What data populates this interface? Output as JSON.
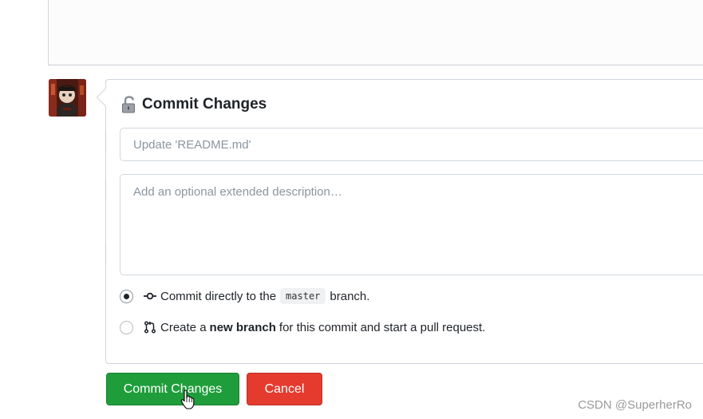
{
  "commit": {
    "title": "Commit Changes",
    "summary_placeholder": "Update 'README.md'",
    "description_placeholder": "Add an optional extended description…",
    "options": [
      {
        "selected": true,
        "prefix": "Commit directly to the",
        "branch": "master",
        "suffix": "branch."
      },
      {
        "selected": false,
        "prefix": "Create a",
        "bold": "new branch",
        "suffix": "for this commit and start a pull request."
      }
    ]
  },
  "buttons": {
    "commit_label": "Commit Changes",
    "cancel_label": "Cancel"
  },
  "watermark": "CSDN @SuperherRo",
  "colors": {
    "commit_button": "#1f9d3b",
    "cancel_button": "#e53b2f"
  },
  "icons": [
    "lock-open-icon",
    "git-commit-icon",
    "git-pull-request-icon",
    "hand-pointer-icon"
  ]
}
